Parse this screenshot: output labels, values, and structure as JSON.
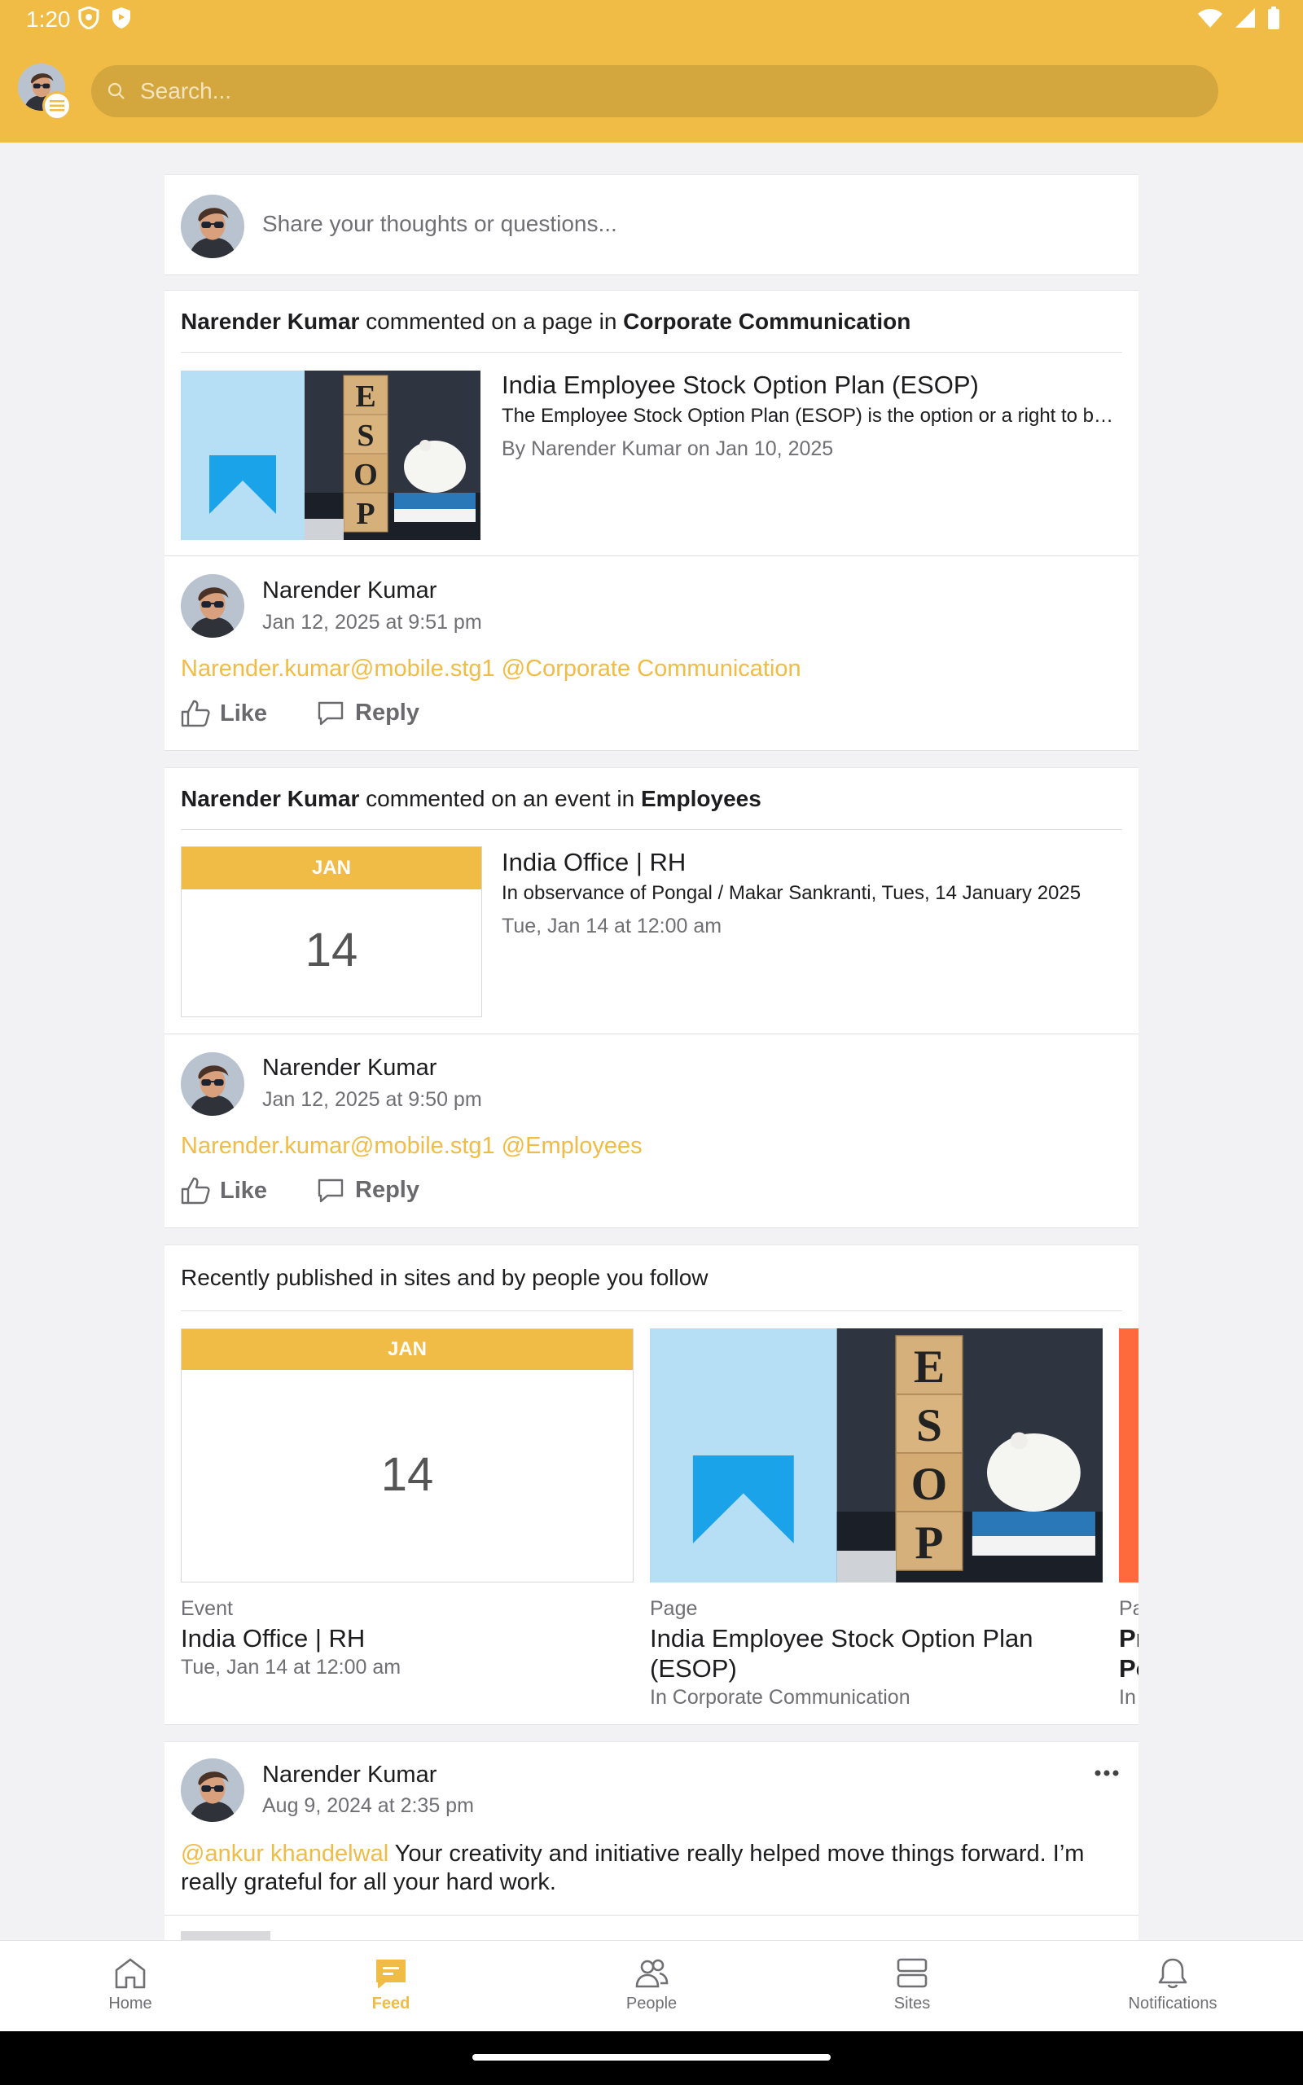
{
  "status_bar": {
    "time": "1:20"
  },
  "search": {
    "placeholder": "Search..."
  },
  "composer": {
    "placeholder": "Share your thoughts or questions..."
  },
  "activity_1": {
    "actor": "Narender Kumar",
    "action": " commented on a page in ",
    "target": "Corporate Communication",
    "item_title": "India Employee Stock Option Plan (ESOP)",
    "item_desc": "The Employee Stock Option Plan (ESOP) is the option or a right to buy shares of a company's stock at a fixed price",
    "item_meta": "By Narender Kumar on Jan 10, 2025",
    "comment": {
      "author": "Narender Kumar",
      "date": "Jan 12, 2025 at 9:51 pm",
      "text": "Narender.kumar@mobile.stg1 @Corporate Communication",
      "like_label": "Like",
      "reply_label": "Reply"
    }
  },
  "activity_2": {
    "actor": "Narender Kumar",
    "action": " commented on an event in ",
    "target": "Employees",
    "cal_month": "JAN",
    "cal_day": "14",
    "item_title": "India Office | RH",
    "item_desc": "In observance of Pongal / Makar Sankranti, Tues, 14 January 2025",
    "item_meta": "Tue, Jan 14 at 12:00 am",
    "comment": {
      "author": "Narender Kumar",
      "date": "Jan 12, 2025 at 9:50 pm",
      "text": "Narender.kumar@mobile.stg1 @Employees",
      "like_label": "Like",
      "reply_label": "Reply"
    }
  },
  "recent": {
    "heading": "Recently published in sites and by people you follow",
    "items": [
      {
        "label": "Event",
        "title": "India Office | RH",
        "sub": "Tue, Jan 14 at 12:00 am",
        "cal_month": "JAN",
        "cal_day": "14"
      },
      {
        "label": "Page",
        "title": "India Employee Stock Option Plan (ESOP)",
        "sub": "In Corporate Communication"
      },
      {
        "label": "Pa",
        "title": "Pr",
        "title2": "Po",
        "sub": "In"
      }
    ]
  },
  "post": {
    "author": "Narender Kumar",
    "date": "Aug 9, 2024 at 2:35 pm",
    "mention": "@ankur khandelwal",
    "text": " Your creativity and initiative really helped move things forward. I’m really grateful for all your hard work."
  },
  "nav": {
    "items": [
      {
        "label": "Home",
        "icon": "home-icon"
      },
      {
        "label": "Feed",
        "icon": "feed-icon"
      },
      {
        "label": "People",
        "icon": "people-icon"
      },
      {
        "label": "Sites",
        "icon": "sites-icon"
      },
      {
        "label": "Notifications",
        "icon": "bell-icon"
      }
    ],
    "active": "Feed"
  },
  "colors": {
    "accent": "#f0bc45",
    "background": "#f2f2f4",
    "esop_blue": "#1aa3e8"
  }
}
